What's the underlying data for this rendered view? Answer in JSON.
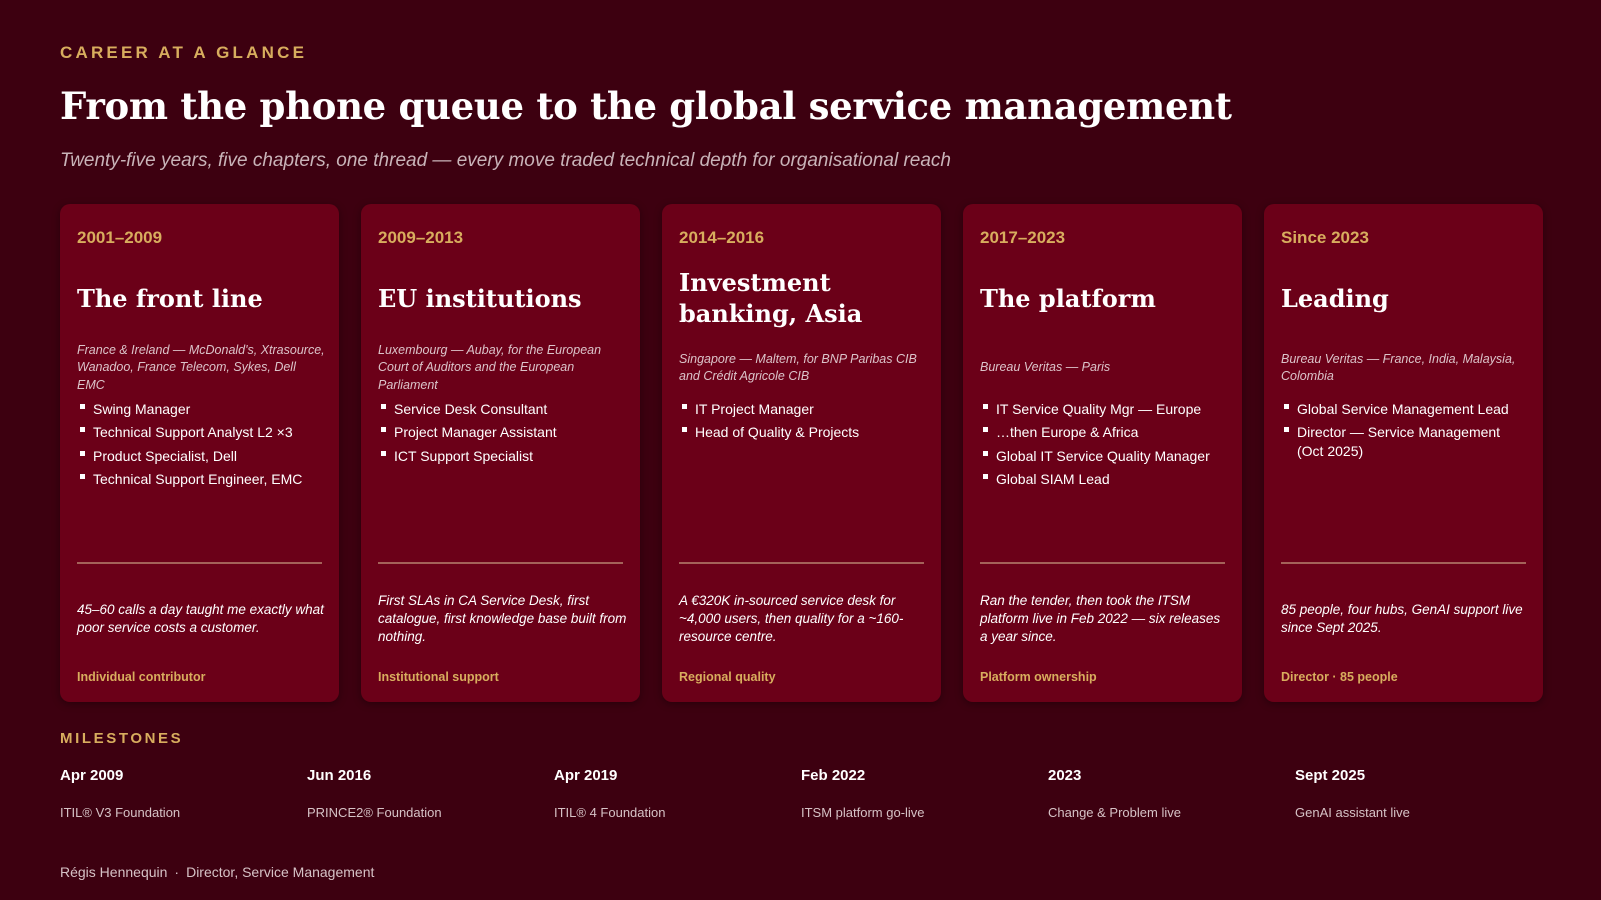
{
  "header": {
    "eyebrow": "CAREER AT A GLANCE",
    "title": "From the phone queue to the global service management",
    "subtitle": "Twenty-five years, five chapters, one thread — every move traded technical depth for organisational reach"
  },
  "cards": [
    {
      "period": "2001–2009",
      "title": "The front line",
      "place": "France & Ireland — McDonald's, Xtrasource, Wanadoo, France Telecom, Sykes, Dell EMC",
      "roles": [
        "Swing Manager",
        "Technical Support Analyst L2 ×3",
        "Product Specialist, Dell",
        "Technical Support Engineer, EMC"
      ],
      "quote": "45–60 calls a day taught me exactly what poor service costs a customer.",
      "tag": "Individual contributor"
    },
    {
      "period": "2009–2013",
      "title": "EU institutions",
      "place": "Luxembourg — Aubay, for the European Court of Auditors and the European Parliament",
      "roles": [
        "Service Desk Consultant",
        "Project Manager Assistant",
        "ICT Support Specialist"
      ],
      "quote": "First SLAs in CA Service Desk, first catalogue, first knowledge base built from nothing.",
      "tag": "Institutional support"
    },
    {
      "period": "2014–2016",
      "title": "Investment banking, Asia",
      "place": "Singapore — Maltem, for BNP Paribas CIB and Crédit Agricole CIB",
      "roles": [
        "IT Project Manager",
        "Head of Quality & Projects"
      ],
      "quote": "A €320K in-sourced service desk for ~4,000 users, then quality for a ~160-resource centre.",
      "tag": "Regional quality"
    },
    {
      "period": "2017–2023",
      "title": "The platform",
      "place": "Bureau Veritas — Paris",
      "roles": [
        "IT Service Quality Mgr — Europe",
        "…then Europe & Africa",
        "Global IT Service Quality Manager",
        "Global SIAM Lead"
      ],
      "quote": "Ran the tender, then took the ITSM platform live in Feb 2022 — six releases a year since.",
      "tag": "Platform ownership"
    },
    {
      "period": "Since 2023",
      "title": "Leading",
      "place": "Bureau Veritas — France, India, Malaysia, Colombia",
      "roles": [
        "Global Service Management Lead",
        "Director — Service Management (Oct 2025)"
      ],
      "quote": "85 people, four hubs, GenAI support live since Sept 2025.",
      "tag": "Director · 85 people"
    }
  ],
  "milestones": {
    "heading": "MILESTONES",
    "items": [
      {
        "date": "Apr 2009",
        "label": "ITIL® V3 Foundation"
      },
      {
        "date": "Jun 2016",
        "label": "PRINCE2® Foundation"
      },
      {
        "date": "Apr 2019",
        "label": "ITIL® 4 Foundation"
      },
      {
        "date": "Feb 2022",
        "label": "ITSM platform go-live"
      },
      {
        "date": "2023",
        "label": "Change & Problem live"
      },
      {
        "date": "Sept 2025",
        "label": "GenAI assistant live"
      }
    ]
  },
  "footer": {
    "name": "Régis Hennequin",
    "separator": "·",
    "role": "Director, Service Management"
  }
}
